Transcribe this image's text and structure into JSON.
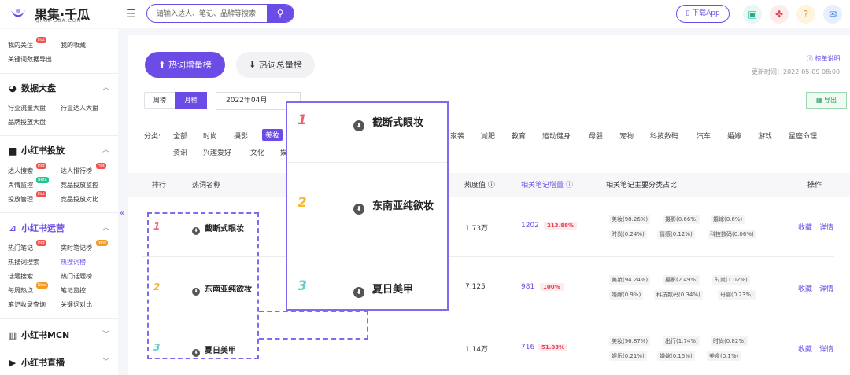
{
  "header": {
    "brand": "果集·千瓜",
    "brand_sub": "QIAN-GUA.COM",
    "search_placeholder": "请输入达人、笔记、品牌等搜索",
    "download_label": "下载App"
  },
  "sidebar": {
    "top_items": [
      "我的关注",
      "我的收藏",
      "关键词数据导出"
    ],
    "groups": [
      {
        "title": "数据大盘",
        "items": [
          "行业流量大盘",
          "行业达人大盘",
          "品牌投放大盘"
        ]
      },
      {
        "title": "小红书投放",
        "items": [
          "达人搜索",
          "达人排行榜",
          "舆情监控",
          "竞品投放监控",
          "投放管理",
          "竞品投放对比"
        ]
      },
      {
        "title": "小红书运营",
        "items": [
          "热门笔记",
          "实时笔记榜",
          "热搜词搜索",
          "热搜词榜",
          "话题搜索",
          "热门话题榜",
          "每周热点",
          "笔记监控",
          "笔记收录查询",
          "关键词对比"
        ]
      },
      {
        "title": "小红书MCN",
        "items": []
      },
      {
        "title": "小红书直播",
        "items": []
      }
    ],
    "badges": {
      "hot": "Hot",
      "beta": "Beta",
      "new": "New"
    }
  },
  "main": {
    "tab_active": "热词增量榜",
    "tab_inactive": "热词总量榜",
    "help": "榜单说明",
    "update_time": "更新时间：2022-05-09 08:00",
    "period_week": "周榜",
    "period_month": "月榜",
    "date": "2022年04月",
    "export": "导出",
    "category_label": "分类:",
    "categories_row1": [
      "全部",
      "时尚",
      "摄影",
      "美妆",
      "家装",
      "减肥",
      "教育",
      "运动健身",
      "母婴",
      "宠物",
      "科技数码",
      "汽车",
      "婚嫁",
      "游戏",
      "星座命理"
    ],
    "categories_row2": [
      "资讯",
      "兴趣爱好",
      "文化",
      "娱"
    ],
    "active_category": "美妆"
  },
  "table": {
    "columns": {
      "rank": "排行",
      "name": "热词名称",
      "heat": "热度值",
      "notes": "相关笔记增量",
      "share": "相关笔记主要分类占比",
      "ops": "操作"
    },
    "rows": [
      {
        "rank": "1",
        "name": "截断式眼妆",
        "heat": "1.73万",
        "notes": "1202",
        "growth": "213.88%",
        "shares": [
          "美妆(98.26%)",
          "摄影(0.66%)",
          "婚嫁(0.6%)",
          "时尚(0.24%)",
          "情感(0.12%)",
          "科技数码(0.06%)"
        ]
      },
      {
        "rank": "2",
        "name": "东南亚纯欲妆",
        "heat": "7,125",
        "notes": "981",
        "growth": "100%",
        "shares": [
          "美妆(94.24%)",
          "摄影(2.49%)",
          "时尚(1.02%)",
          "婚嫁(0.9%)",
          "科技数码(0.34%)",
          "母婴(0.23%)"
        ]
      },
      {
        "rank": "3",
        "name": "夏日美甲",
        "heat": "1.14万",
        "notes": "716",
        "growth": "51.03%",
        "shares": [
          "美妆(96.87%)",
          "出行(1.74%)",
          "时尚(0.82%)",
          "娱乐(0.21%)",
          "婚嫁(0.15%)",
          "美食(0.1%)"
        ]
      }
    ],
    "op_collect": "收藏",
    "op_detail": "详情"
  },
  "colors": {
    "accent": "#6b4ce6",
    "rank1": "#f0616d",
    "rank2": "#f5b932",
    "rank3": "#5fcfc8",
    "growth": "#e84354"
  }
}
